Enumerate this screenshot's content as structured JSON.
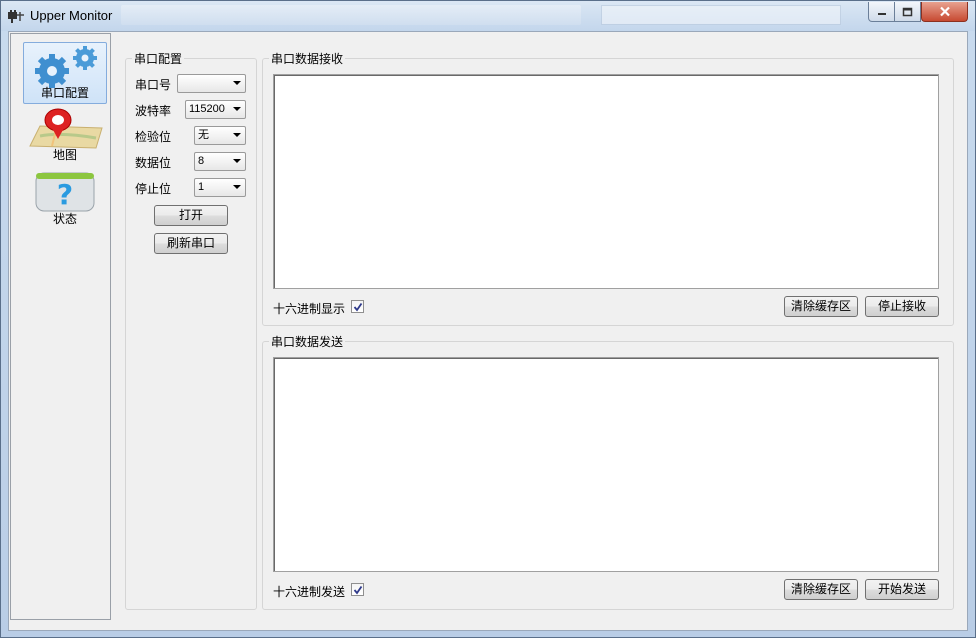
{
  "window": {
    "title": "Upper Monitor"
  },
  "nav": {
    "items": [
      {
        "label": "串口配置",
        "icon": "gears-icon",
        "selected": true
      },
      {
        "label": "地图",
        "icon": "map-pin-icon",
        "selected": false
      },
      {
        "label": "状态",
        "icon": "help-question-icon",
        "selected": false
      }
    ]
  },
  "config": {
    "title": "串口配置",
    "port_label": "串口号",
    "port_value": "",
    "baud_label": "波特率",
    "baud_value": "115200",
    "parity_label": "检验位",
    "parity_value": "无",
    "databits_label": "数据位",
    "databits_value": "8",
    "stopbits_label": "停止位",
    "stopbits_value": "1",
    "open_button": "打开",
    "refresh_button": "刷新串口"
  },
  "receive": {
    "title": "串口数据接收",
    "hex_label": "十六进制显示",
    "hex_checked": true,
    "clear_button": "清除缓存区",
    "stop_button": "停止接收",
    "content": ""
  },
  "send": {
    "title": "串口数据发送",
    "hex_label": "十六进制发送",
    "hex_checked": true,
    "clear_button": "清除缓存区",
    "start_button": "开始发送",
    "content": ""
  }
}
